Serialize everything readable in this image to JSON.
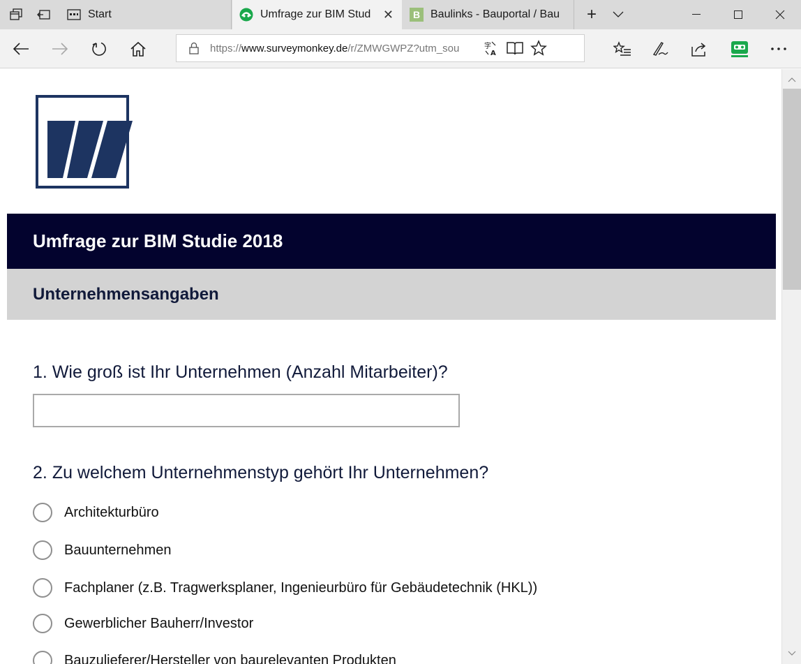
{
  "browser": {
    "tabs": [
      {
        "label": "Start",
        "active": false
      },
      {
        "label": "Umfrage zur BIM Stud",
        "active": true
      },
      {
        "label": "Baulinks - Bauportal / Bau",
        "active": false
      }
    ],
    "address": {
      "scheme": "https://",
      "host": "www.surveymonkey.de",
      "path": "/r/ZMWGWPZ?utm_sou"
    },
    "icons": {
      "tab_manager": "tabs-aside-icon",
      "back": "back-arrow-icon",
      "forward": "forward-arrow-icon",
      "refresh": "refresh-icon",
      "home": "home-icon",
      "lock": "lock-icon",
      "translate": "translate-icon",
      "reading_view": "reading-view-icon",
      "favorite": "star-icon",
      "favorites_hub": "favorites-list-icon",
      "notes": "pen-icon",
      "share": "share-icon",
      "extension": "extension-icon",
      "more": "more-icon"
    },
    "colors": {
      "extension": "#1aa84c",
      "active_favicon": "#1aa84c"
    }
  },
  "survey": {
    "title": "Umfrage zur BIM Studie 2018",
    "page_title": "Unternehmensangaben",
    "colors": {
      "title_bar": "#03032e",
      "page_bar": "#d3d3d3",
      "logo": "#1d3461"
    },
    "questions": [
      {
        "number": "1.",
        "text": "Wie groß ist Ihr Unternehmen (Anzahl Mitarbeiter)?",
        "answer": ""
      },
      {
        "number": "2.",
        "text": "Zu welchem Unternehmenstyp gehört Ihr Unternehmen?",
        "options": [
          "Architekturbüro",
          "Bauunternehmen",
          "Fachplaner (z.B. Tragwerksplaner, Ingenieurbüro für Gebäudetechnik (HKL))",
          "Gewerblicher Bauherr/Investor",
          "Bauzulieferer/Hersteller von baurelevanten Produkten"
        ]
      }
    ]
  }
}
